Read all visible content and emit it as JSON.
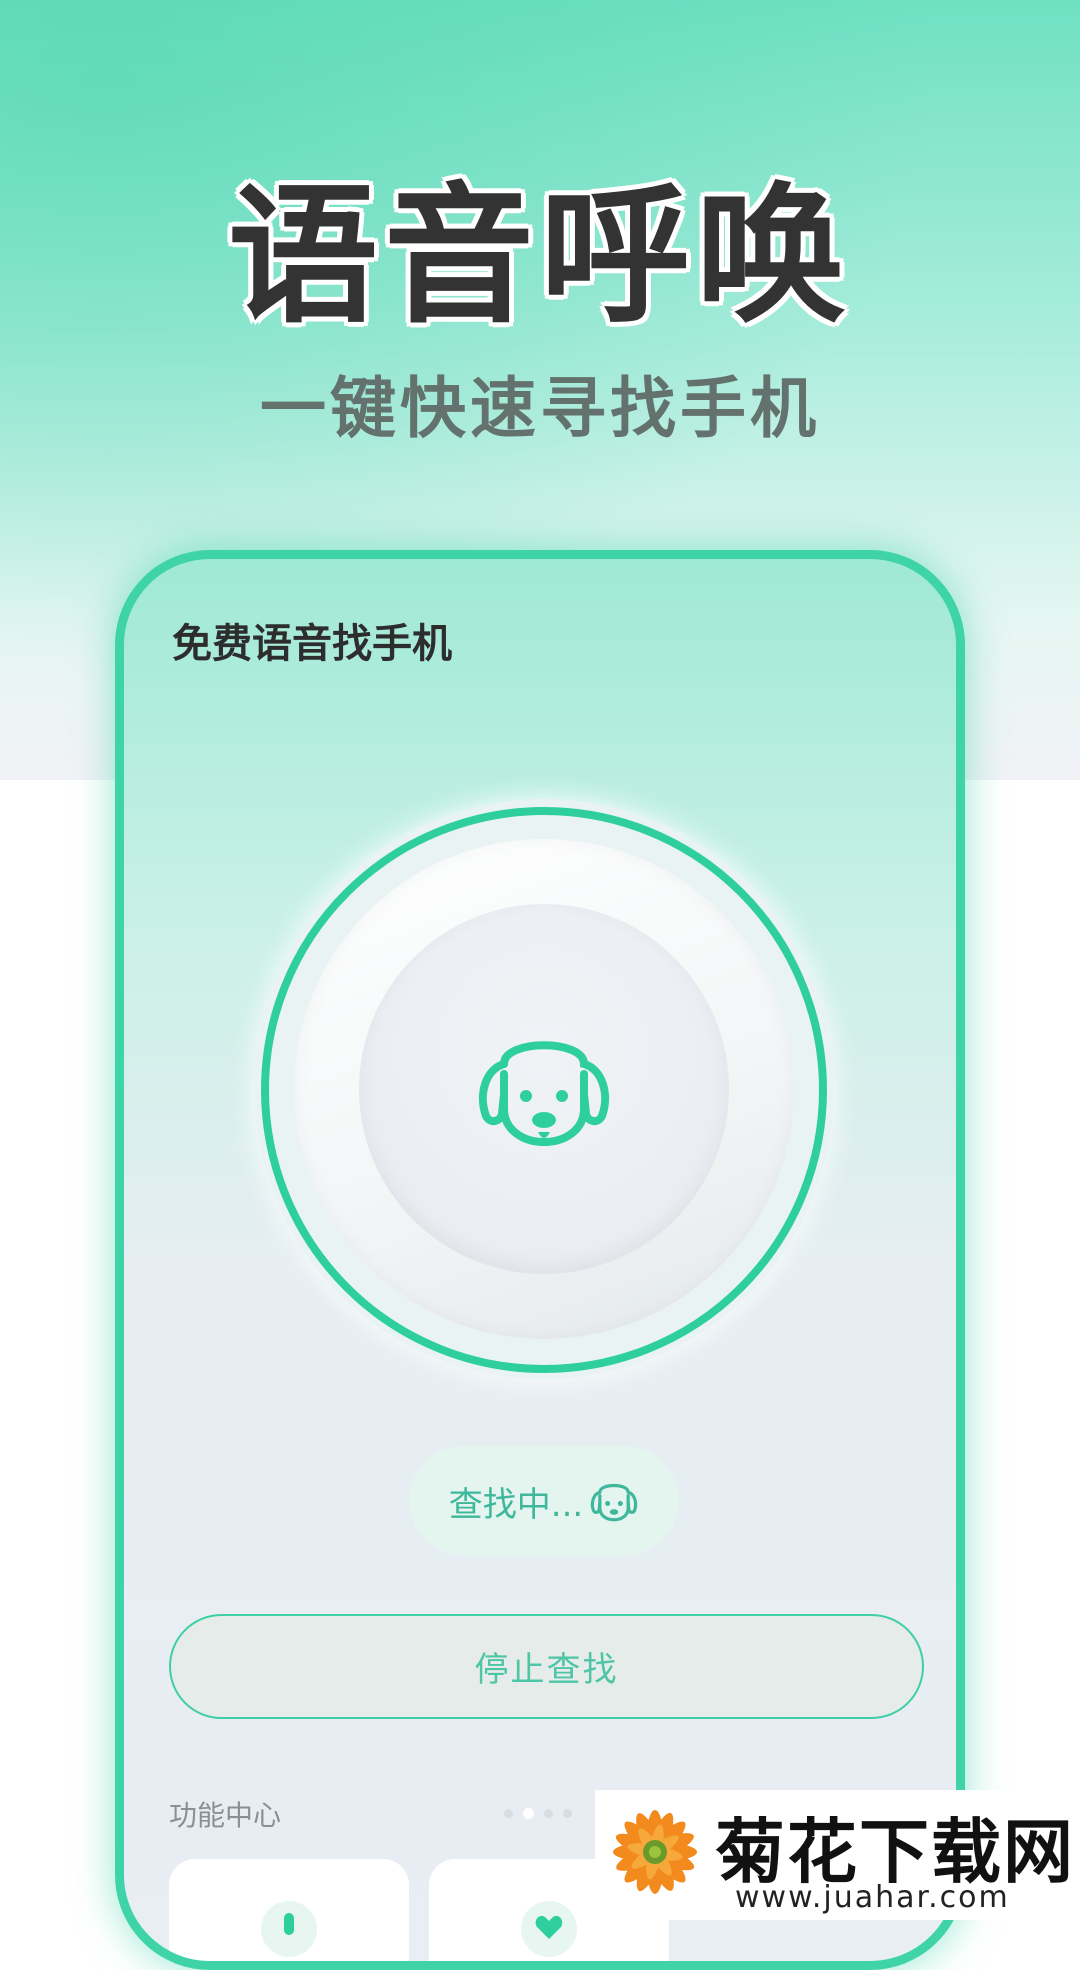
{
  "headline": "语音呼唤",
  "subheadline": "一键快速寻找手机",
  "phone": {
    "title": "免费语音找手机",
    "status": "查找中...",
    "stop_button": "停止查找",
    "section_label": "功能中心"
  },
  "icons": [
    "dog-icon",
    "small-dog-icon"
  ],
  "colors": {
    "accent": "#2fcf9d",
    "frame": "#3fd4a7",
    "status_text": "#3fb79a"
  },
  "watermark": {
    "name": "菊花下载网",
    "url": "www.juahar.com"
  }
}
